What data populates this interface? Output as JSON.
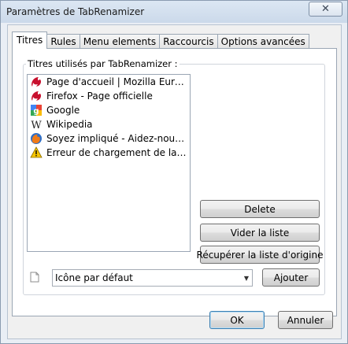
{
  "window": {
    "title": "Paramètres de TabRenamizer",
    "close_label": "✕"
  },
  "tabs": [
    {
      "label": "Titres",
      "active": true
    },
    {
      "label": "Rules"
    },
    {
      "label": "Menu elements"
    },
    {
      "label": "Raccourcis"
    },
    {
      "label": "Options avancées"
    }
  ],
  "group": {
    "label": "Titres utilisés par TabRenamizer :"
  },
  "titles_list": [
    {
      "icon": "firefox-red-icon",
      "text": "Page d'accueil | Mozilla Europe"
    },
    {
      "icon": "firefox-red-icon",
      "text": "Firefox - Page officielle"
    },
    {
      "icon": "google-icon",
      "text": "Google"
    },
    {
      "icon": "wikipedia-icon",
      "text": "Wikipedia"
    },
    {
      "icon": "firefox-icon",
      "text": "Soyez impliqué - Aidez-nous à di..."
    },
    {
      "icon": "warning-icon",
      "text": "Erreur de chargement de la page"
    }
  ],
  "buttons": {
    "delete": "Delete",
    "clear": "Vider la liste",
    "restore": "Récupérer la liste d'origine",
    "add": "Ajouter",
    "ok": "OK",
    "cancel": "Annuler"
  },
  "icon_select": {
    "value": "Icône par défaut",
    "icon": "blank-page-icon"
  }
}
